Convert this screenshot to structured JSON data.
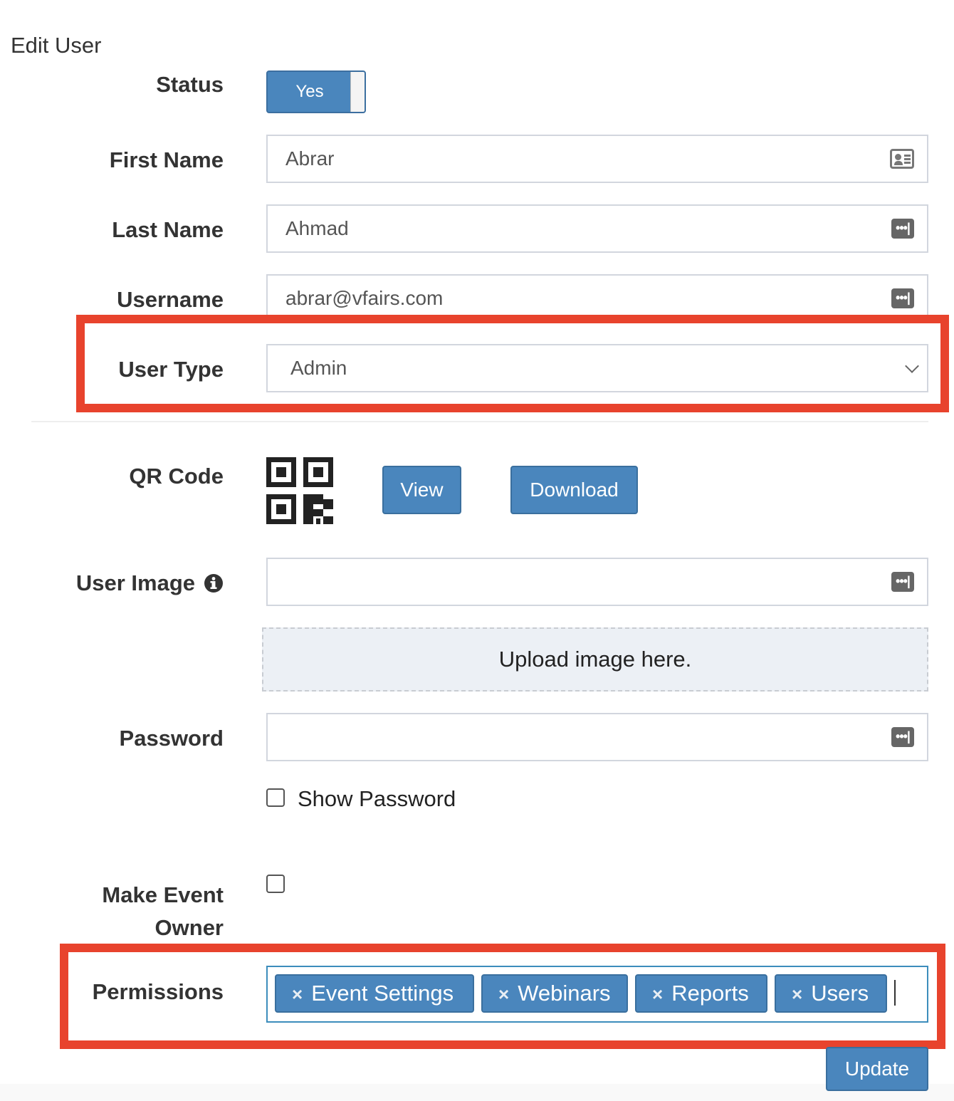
{
  "page": {
    "title": "Edit User"
  },
  "form": {
    "status": {
      "label": "Status",
      "toggle_on_text": "Yes"
    },
    "first_name": {
      "label": "First Name",
      "value": "Abrar",
      "icon": "id-card-icon"
    },
    "last_name": {
      "label": "Last Name",
      "value": "Ahmad",
      "icon": "ellipsis-icon"
    },
    "username": {
      "label": "Username",
      "value": "abrar@vfairs.com",
      "icon": "ellipsis-icon"
    },
    "user_type": {
      "label": "User Type",
      "selected": "Admin"
    },
    "qr_code": {
      "label": "QR Code",
      "view_label": "View",
      "download_label": "Download"
    },
    "user_image": {
      "label": "User Image",
      "info_icon": "info-circle-icon",
      "value": "",
      "upload_text": "Upload image here."
    },
    "password": {
      "label": "Password",
      "value": "",
      "show_password_label": "Show Password"
    },
    "event_owner": {
      "label_line1": "Make Event",
      "label_line2": "Owner"
    },
    "permissions": {
      "label": "Permissions",
      "tags": [
        "Event Settings",
        "Webinars",
        "Reports",
        "Users"
      ],
      "remove_glyph": "×"
    },
    "update_label": "Update",
    "ellipsis_glyph": "•••|"
  },
  "colors": {
    "primary": "#4a86bd",
    "highlight": "#e8432d",
    "upload_bg": "#ecf0f5"
  }
}
